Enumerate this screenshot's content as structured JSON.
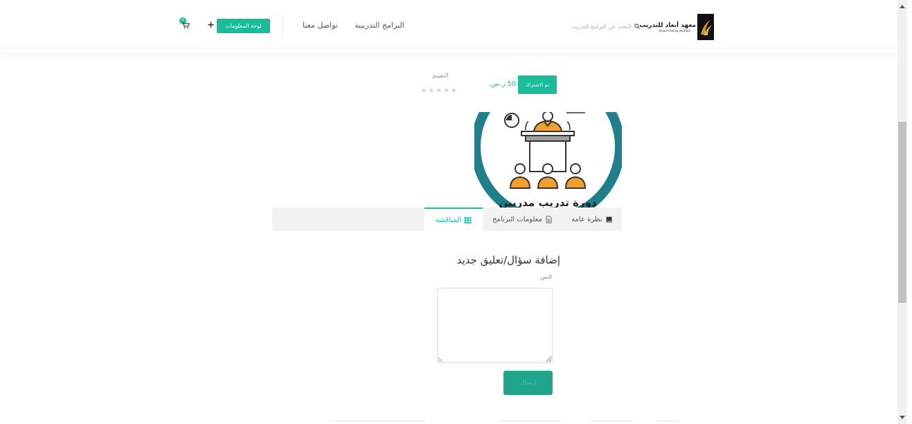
{
  "header": {
    "logo_text_ar": "معهد أبعاد للتدريب",
    "logo_text_en": "Aread training institute",
    "search_placeholder": "البحث عن البرامج التدريب",
    "nav_programs": "البرامج التدريبية",
    "nav_contact": "تواصل معنا",
    "dashboard_button": "لوحة المعلومات",
    "plus": "+",
    "cart_count": "0"
  },
  "course": {
    "subscribed_button": "تم الاشتراك",
    "price": "50 ر.س.",
    "rating_label": "التقييم",
    "stars": "★★★★★",
    "image_caption": "دورة تدريب مدربين"
  },
  "tabs": [
    {
      "label": "نظرة عامة",
      "icon": "book-icon"
    },
    {
      "label": "معلومات البرنامج",
      "icon": "document-icon"
    },
    {
      "label": "المناقشة",
      "icon": "grid-icon"
    }
  ],
  "form": {
    "title": "إضافة سؤال/تعليق جديد",
    "text_label": "النص",
    "text_value": "",
    "submit_label": "إرسال"
  },
  "colors": {
    "accent": "#1abc9c",
    "submit": "#20a58b",
    "orange": "#f0a030",
    "teal_ring": "#1f7f8a"
  }
}
